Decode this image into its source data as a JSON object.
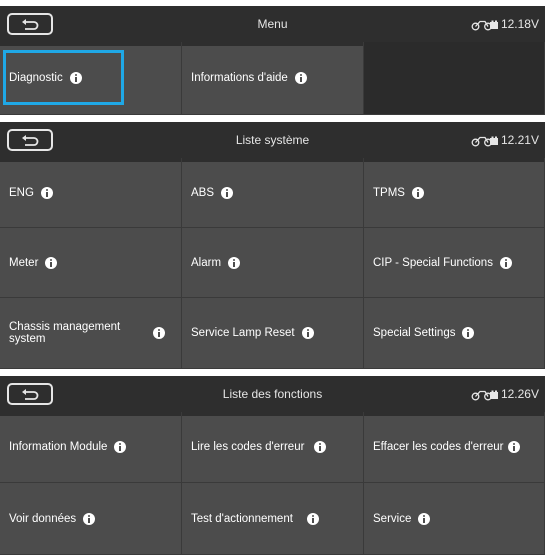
{
  "accent_color": "#1fa8e6",
  "panels": [
    {
      "header": {
        "title": "Menu",
        "battery_icon": "motorcycle-battery-icon",
        "voltage": "12.18V"
      },
      "selected": "Diagnostic",
      "cells": [
        "Diagnostic",
        "Informations d'aide",
        ""
      ]
    },
    {
      "header": {
        "title": "Liste système",
        "battery_icon": "motorcycle-battery-icon",
        "voltage": "12.21V"
      },
      "cells": [
        "ENG",
        "ABS",
        "TPMS",
        "Meter",
        "Alarm",
        "CIP - Special Functions",
        "Chassis management system",
        "Service Lamp Reset",
        "Special Settings"
      ]
    },
    {
      "header": {
        "title": "Liste des fonctions",
        "battery_icon": "motorcycle-battery-icon",
        "voltage": "12.26V"
      },
      "cells": [
        "Information Module",
        "Lire les codes d'erreur",
        "Effacer les codes d'erreur",
        "Voir données",
        "Test d'actionnement",
        "Service"
      ]
    }
  ]
}
